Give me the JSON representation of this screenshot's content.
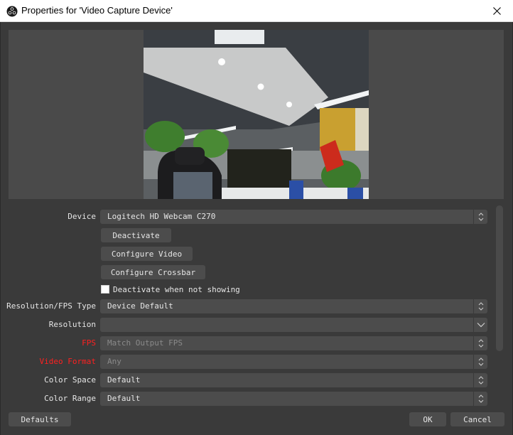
{
  "window": {
    "title": "Properties for 'Video Capture Device'",
    "app_icon": "obs-logo-icon",
    "close_icon": "close-icon"
  },
  "preview": {
    "description": "Webcam preview of an office interior"
  },
  "properties": {
    "device": {
      "label": "Device",
      "value": "Logitech HD Webcam C270",
      "arrow": "updown"
    },
    "buttons": {
      "deactivate": "Deactivate",
      "configure_video": "Configure Video",
      "configure_crossbar": "Configure Crossbar"
    },
    "deactivate_when_not_showing": {
      "label": "Deactivate when not showing",
      "checked": false
    },
    "resolution_fps_type": {
      "label": "Resolution/FPS Type",
      "value": "Device Default",
      "arrow": "updown"
    },
    "resolution": {
      "label": "Resolution",
      "value": "",
      "arrow": "down"
    },
    "fps": {
      "label": "FPS",
      "value": "Match Output FPS",
      "arrow": "updown",
      "label_color": "#ff2020",
      "disabled": true
    },
    "video_format": {
      "label": "Video Format",
      "value": "Any",
      "arrow": "updown",
      "label_color": "#ff2020",
      "disabled": true
    },
    "color_space": {
      "label": "Color Space",
      "value": "Default",
      "arrow": "updown"
    },
    "color_range": {
      "label": "Color Range",
      "value": "Default",
      "arrow": "updown"
    }
  },
  "footer": {
    "defaults": "Defaults",
    "ok": "OK",
    "cancel": "Cancel"
  },
  "colors": {
    "background": "#3a3a3a",
    "control": "#4c4c4c",
    "error_label": "#ff2020"
  }
}
